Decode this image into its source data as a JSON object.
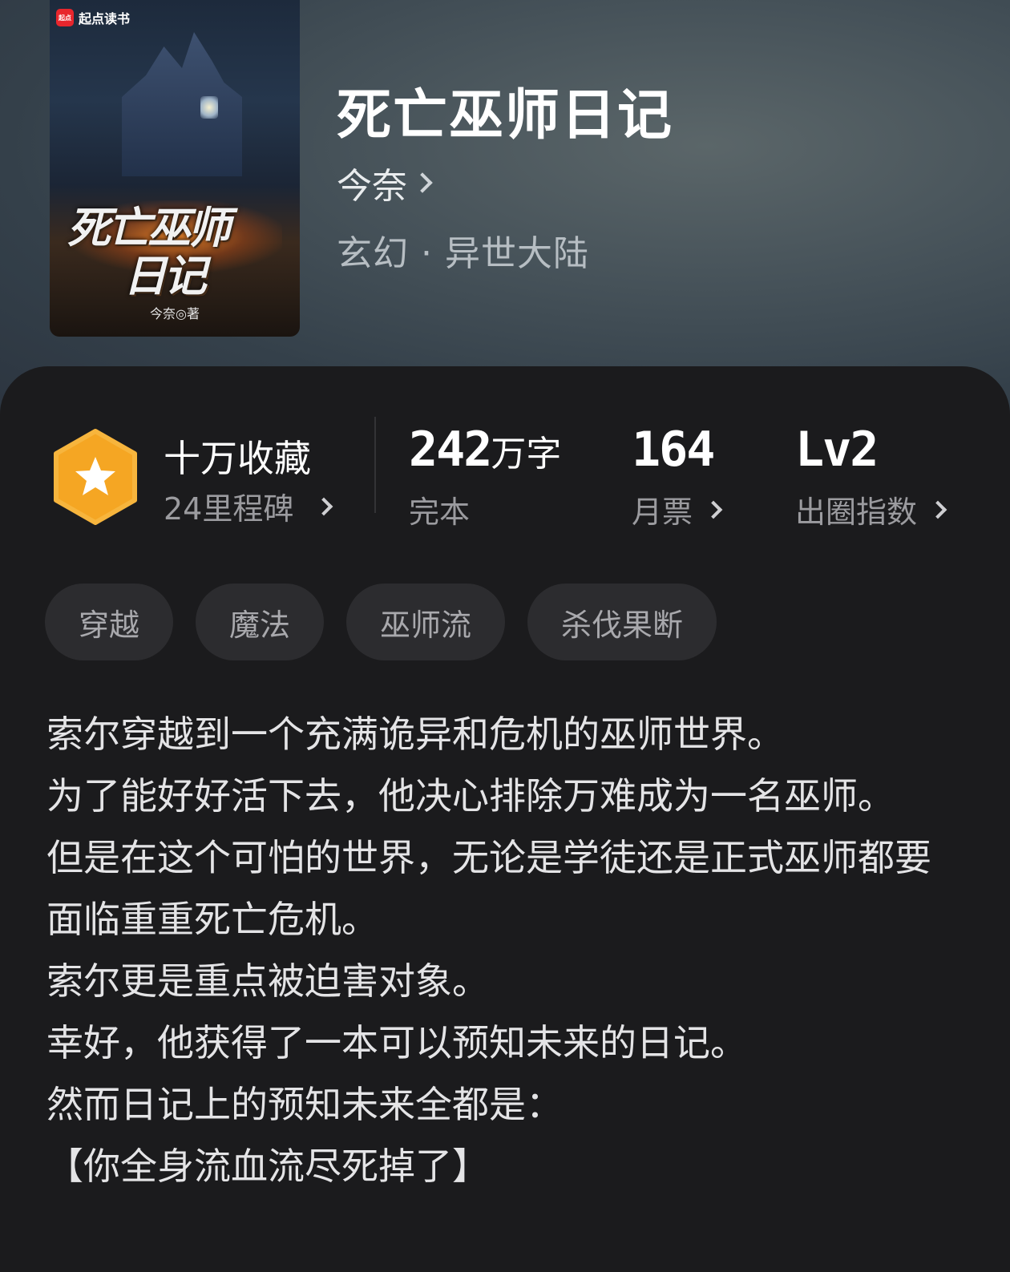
{
  "book": {
    "title": "死亡巫师日记",
    "author": "今奈",
    "genre": "玄幻 · 异世大陆",
    "cover": {
      "brand": "起点读书",
      "logo_text": "起点",
      "title_line1": "死亡巫师",
      "title_line2": "日记",
      "author_credit": "今奈◎著"
    }
  },
  "stats": {
    "favorites": {
      "label": "十万收藏",
      "milestone": "24里程碑"
    },
    "words": {
      "value": "242",
      "unit": "万字",
      "label": "完本"
    },
    "monthly_votes": {
      "value": "164",
      "label": "月票"
    },
    "popularity": {
      "value": "Lv2",
      "label": "出圈指数"
    }
  },
  "tags": [
    "穿越",
    "魔法",
    "巫师流",
    "杀伐果断"
  ],
  "description": [
    "索尔穿越到一个充满诡异和危机的巫师世界。",
    "为了能好好活下去，他决心排除万难成为一名巫师。",
    "但是在这个可怕的世界，无论是学徒还是正式巫师都要面临重重死亡危机。",
    "索尔更是重点被迫害对象。",
    "幸好，他获得了一本可以预知未来的日记。",
    "然而日记上的预知未来全都是：",
    "【你全身流血流尽死掉了】"
  ],
  "colors": {
    "badge": "#f5a623",
    "panel_bg": "#1b1b1d",
    "tag_bg": "#2c2c2f"
  },
  "icons": {
    "badge": "star-hexagon-icon",
    "chevron": "chevron-right-icon"
  }
}
